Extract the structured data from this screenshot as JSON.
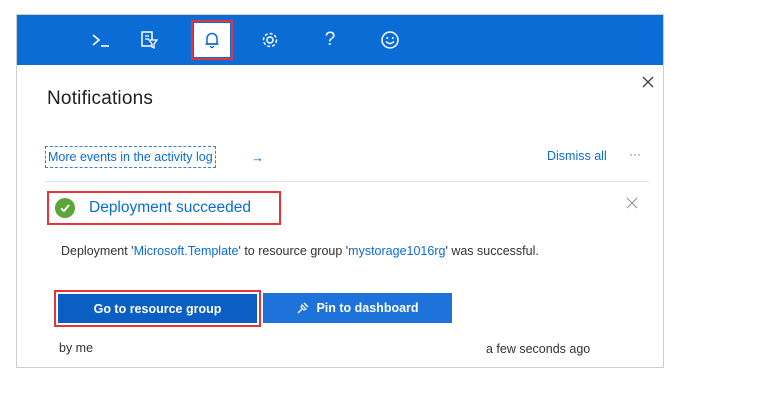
{
  "topbar": {
    "color": "#0b6cd6",
    "icons": [
      "cloud-shell-icon",
      "directory-filter-icon",
      "notifications-bell-icon",
      "settings-gear-icon",
      "help-icon",
      "feedback-smiley-icon"
    ],
    "help_glyph": "?"
  },
  "panel": {
    "title": "Notifications",
    "activity_link": "More events in the activity log",
    "activity_arrow": "→",
    "dismiss_all": "Dismiss all",
    "more": "···"
  },
  "notification": {
    "status": "success",
    "status_color": "#5aa63a",
    "title": "Deployment succeeded",
    "message_prefix": "Deployment '",
    "template_name": "Microsoft.Template",
    "message_middle": "' to resource group '",
    "resource_group": "mystorage1016rg",
    "message_suffix": "' was successful.",
    "primary_button": "Go to resource group",
    "secondary_button": "Pin to dashboard",
    "author": "by me",
    "timestamp": "a few seconds ago"
  }
}
